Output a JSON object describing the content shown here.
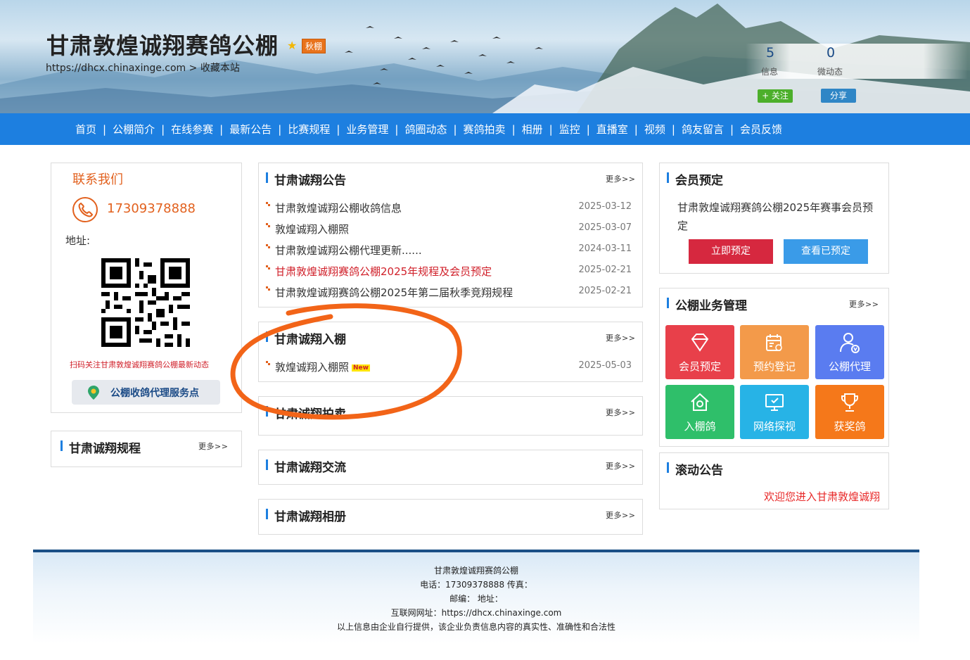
{
  "header": {
    "title": "甘肃敦煌诚翔赛鸽公棚",
    "season_badge": "秋棚",
    "url": "https://dhcx.chinaxinge.com",
    "bookmark": "> 收藏本站",
    "stats": [
      {
        "value": "5",
        "label": "信息"
      },
      {
        "value": "0",
        "label": "微动态"
      }
    ],
    "follow_label": "+ 关注",
    "share_label": "分享"
  },
  "nav": {
    "items": [
      "首页",
      "公棚简介",
      "在线参赛",
      "最新公告",
      "比赛规程",
      "业务管理",
      "鸽圈动态",
      "赛鸽拍卖",
      "相册",
      "监控",
      "直播室",
      "视频",
      "鸽友留言",
      "会员反馈"
    ],
    "separator": "|"
  },
  "contact": {
    "title": "联系我们",
    "phone": "17309378888",
    "address_label": "地址:",
    "qr_caption": "扫码关注甘肃敦煌诚翔赛鸽公棚最新动态",
    "agent_button": "公棚收鸽代理服务点"
  },
  "rules_panel": {
    "title": "甘肃诚翔规程",
    "more": "更多>>"
  },
  "announcements": {
    "title": "甘肃诚翔公告",
    "more": "更多>>",
    "items": [
      {
        "title": "甘肃敦煌诚翔公棚收鸽信息",
        "date": "2025-03-12",
        "highlight": false
      },
      {
        "title": "敦煌诚翔入棚照",
        "date": "2025-03-07",
        "highlight": false
      },
      {
        "title": "甘肃敦煌诚翔公棚代理更新......",
        "date": "2024-03-11",
        "highlight": false
      },
      {
        "title": "甘肃敦煌诚翔赛鸽公棚2025年规程及会员预定",
        "date": "2025-02-21",
        "highlight": true
      },
      {
        "title": "甘肃敦煌诚翔赛鸽公棚2025年第二届秋季竞翔规程",
        "date": "2025-02-21",
        "highlight": false
      }
    ]
  },
  "entry": {
    "title": "甘肃诚翔入棚",
    "more": "更多>>",
    "items": [
      {
        "title": "敦煌诚翔入棚照",
        "tag": "New",
        "date": "2025-05-03"
      }
    ]
  },
  "auction": {
    "title": "甘肃诚翔拍卖",
    "more": "更多>>"
  },
  "exchange": {
    "title": "甘肃诚翔交流",
    "more": "更多>>"
  },
  "album": {
    "title": "甘肃诚翔相册",
    "more": "更多>>"
  },
  "member_booking": {
    "title": "会员预定",
    "text": "甘肃敦煌诚翔赛鸽公棚2025年赛事会员预定",
    "book_button": "立即预定",
    "view_button": "查看已预定"
  },
  "business": {
    "title": "公棚业务管理",
    "more": "更多>>",
    "tiles": [
      {
        "label": "会员预定",
        "color": "#e8404a",
        "icon": "diamond-icon"
      },
      {
        "label": "预约登记",
        "color": "#f39a4a",
        "icon": "calendar-icon"
      },
      {
        "label": "公棚代理",
        "color": "#5a7cf0",
        "icon": "agent-icon"
      },
      {
        "label": "入棚鸽",
        "color": "#2fbf6a",
        "icon": "house-icon"
      },
      {
        "label": "网络探视",
        "color": "#27b3e6",
        "icon": "monitor-icon"
      },
      {
        "label": "获奖鸽",
        "color": "#f5781a",
        "icon": "trophy-icon"
      }
    ]
  },
  "scrolling": {
    "title": "滚动公告",
    "text": "欢迎您进入甘肃敦煌诚翔"
  },
  "footer": {
    "lines": [
      "甘肃敦煌诚翔赛鸽公棚",
      "电话：17309378888 传真：",
      "邮编： 地址：",
      "互联网网址：https://dhcx.chinaxinge.com",
      "以上信息由企业自行提供，该企业负责信息内容的真实性、准确性和合法性"
    ]
  },
  "colors": {
    "nav": "#1d7fe0",
    "accent_orange": "#e2611e",
    "highlight_red": "#d0202a",
    "annotation": "#f26418"
  }
}
